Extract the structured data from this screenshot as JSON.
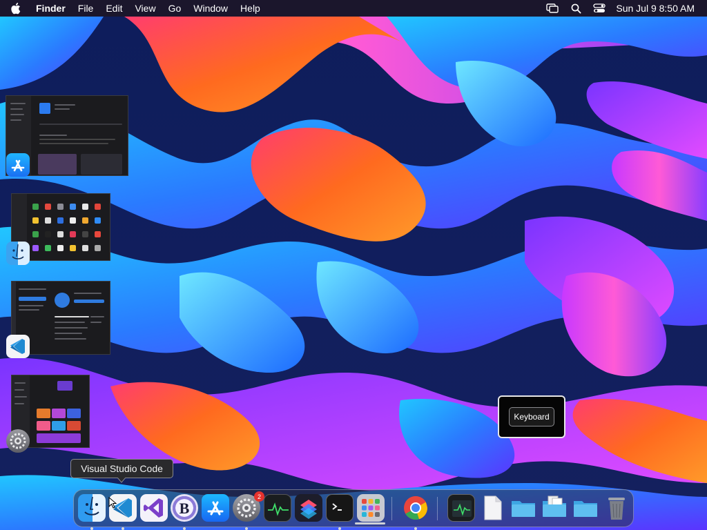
{
  "menubar": {
    "app_name": "Finder",
    "menus": [
      "File",
      "Edit",
      "View",
      "Go",
      "Window",
      "Help"
    ],
    "clock": "Sun Jul 9  8:50 AM",
    "status_icons": [
      "screen-mirroring-icon",
      "spotlight-search-icon",
      "control-center-icon"
    ]
  },
  "switcher": {
    "windows": [
      {
        "app": "App Store",
        "icon": "app-store-icon"
      },
      {
        "app": "Finder",
        "icon": "finder-icon"
      },
      {
        "app": "Visual Studio Code",
        "icon": "vscode-icon"
      },
      {
        "app": "System Settings",
        "icon": "system-settings-icon"
      }
    ]
  },
  "tooltip": {
    "text": "Visual Studio Code"
  },
  "keyboard_hud": {
    "label": "Keyboard"
  },
  "dock": {
    "items": [
      {
        "name": "Finder",
        "icon": "finder-icon",
        "running": true
      },
      {
        "name": "Visual Studio Code",
        "icon": "vscode-icon",
        "running": true
      },
      {
        "name": "Visual Studio",
        "icon": "visual-studio-icon",
        "running": false
      },
      {
        "name": "BBEdit",
        "icon": "bbedit-icon",
        "running": true
      },
      {
        "name": "App Store",
        "icon": "app-store-icon",
        "running": false
      },
      {
        "name": "System Settings",
        "icon": "system-settings-icon",
        "running": true,
        "badge": "2"
      },
      {
        "name": "Activity Monitor",
        "icon": "activity-monitor-icon",
        "running": false
      },
      {
        "name": "Shortcuts",
        "icon": "shortcuts-icon",
        "running": false
      },
      {
        "name": "Terminal",
        "icon": "terminal-icon",
        "running": true
      },
      {
        "name": "Launchpad",
        "icon": "launchpad-icon",
        "running": false
      },
      {
        "name": "Google Chrome",
        "icon": "chrome-icon",
        "running": true
      },
      {
        "name": "Activity Monitor (minimized)",
        "icon": "activity-monitor-window-icon",
        "running": false
      },
      {
        "name": "Document",
        "icon": "document-icon",
        "running": false
      },
      {
        "name": "Folder",
        "icon": "folder-icon",
        "running": false
      },
      {
        "name": "Downloads",
        "icon": "downloads-folder-icon",
        "running": false
      },
      {
        "name": "Folder",
        "icon": "folder-icon",
        "running": false
      },
      {
        "name": "Trash",
        "icon": "trash-icon",
        "running": false
      }
    ]
  },
  "colors": {
    "menubar_bg": "#1c1628",
    "dock_badge": "#e5322d",
    "vscode_blue": "#1f8ad2",
    "folder_blue": "#4fb4ea"
  }
}
